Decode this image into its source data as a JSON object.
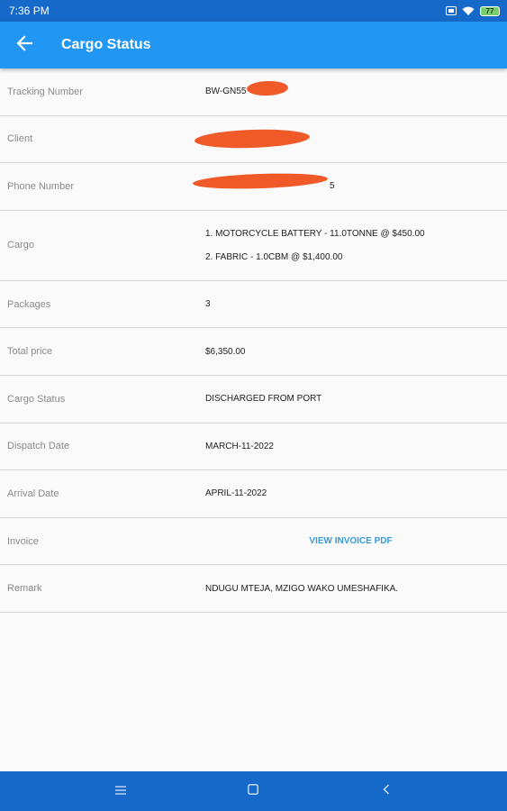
{
  "status_bar": {
    "time": "7:36 PM",
    "battery": "77",
    "icons": [
      "sim-icon",
      "wifi-icon",
      "battery-icon"
    ]
  },
  "app_bar": {
    "title": "Cargo Status",
    "back_icon": "arrow-back-icon"
  },
  "rows": {
    "tracking": {
      "label": "Tracking Number",
      "value": "BW-GN55"
    },
    "client": {
      "label": "Client",
      "value": ""
    },
    "phone": {
      "label": "Phone Number",
      "value": "5"
    },
    "cargo": {
      "label": "Cargo",
      "items": [
        "1. MOTORCYCLE BATTERY - 11.0TONNE @ $450.00",
        "2. FABRIC - 1.0CBM @ $1,400.00"
      ]
    },
    "packages": {
      "label": "Packages",
      "value": "3"
    },
    "total_price": {
      "label": "Total price",
      "value": "$6,350.00"
    },
    "cargo_status": {
      "label": "Cargo Status",
      "value": "DISCHARGED FROM PORT"
    },
    "dispatch_date": {
      "label": "Dispatch Date",
      "value": "MARCH-11-2022"
    },
    "arrival_date": {
      "label": "Arrival Date",
      "value": "APRIL-11-2022"
    },
    "invoice": {
      "label": "Invoice",
      "link": "VIEW INVOICE PDF"
    },
    "remark": {
      "label": "Remark",
      "value": "NDUGU MTEJA, MZIGO WAKO UMESHAFIKA."
    }
  },
  "nav_bar": {
    "icons": [
      "menu-icon",
      "home-square-icon",
      "back-chevron-icon"
    ]
  },
  "colors": {
    "primary": "#2196f3",
    "primary_dark": "#1769c9",
    "link": "#3a9ad9",
    "redaction": "#f05a28"
  }
}
